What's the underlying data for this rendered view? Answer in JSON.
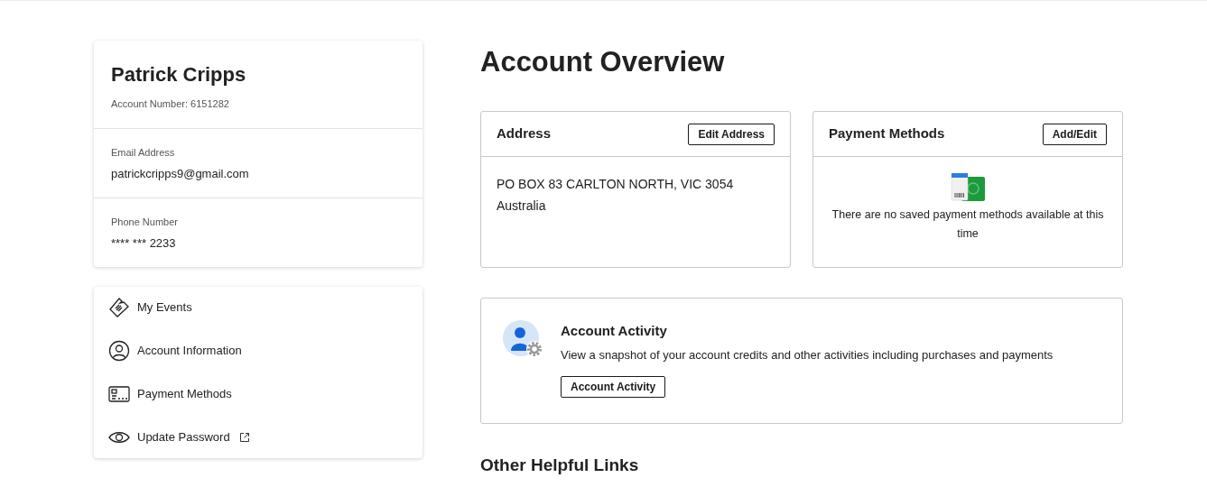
{
  "profile": {
    "name": "Patrick Cripps",
    "account_number": "Account Number: 6151282",
    "fields": [
      {
        "label": "Email Address",
        "value": "patrickcripps9@gmail.com"
      },
      {
        "label": "Phone Number",
        "value": "**** *** 2233"
      }
    ]
  },
  "menu": [
    {
      "kind": "ticket",
      "label": "My Events",
      "external": false
    },
    {
      "kind": "user",
      "label": "Account Information",
      "external": false
    },
    {
      "kind": "card",
      "label": "Payment Methods",
      "external": false
    },
    {
      "kind": "eye",
      "label": "Update Password",
      "external": true
    }
  ],
  "page_title": "Account Overview",
  "address_card": {
    "title": "Address",
    "button": "Edit Address",
    "lines": [
      "PO BOX 83 CARLTON NORTH, VIC 3054",
      "Australia"
    ]
  },
  "payment_card": {
    "title": "Payment Methods",
    "button": "Add/Edit",
    "message": "There are no saved payment methods available at this time"
  },
  "activity_card": {
    "title": "Account Activity",
    "description": "View a snapshot of your account credits and other activities including purchases and payments",
    "button": "Account Activity"
  },
  "section_title": "Other Helpful Links"
}
